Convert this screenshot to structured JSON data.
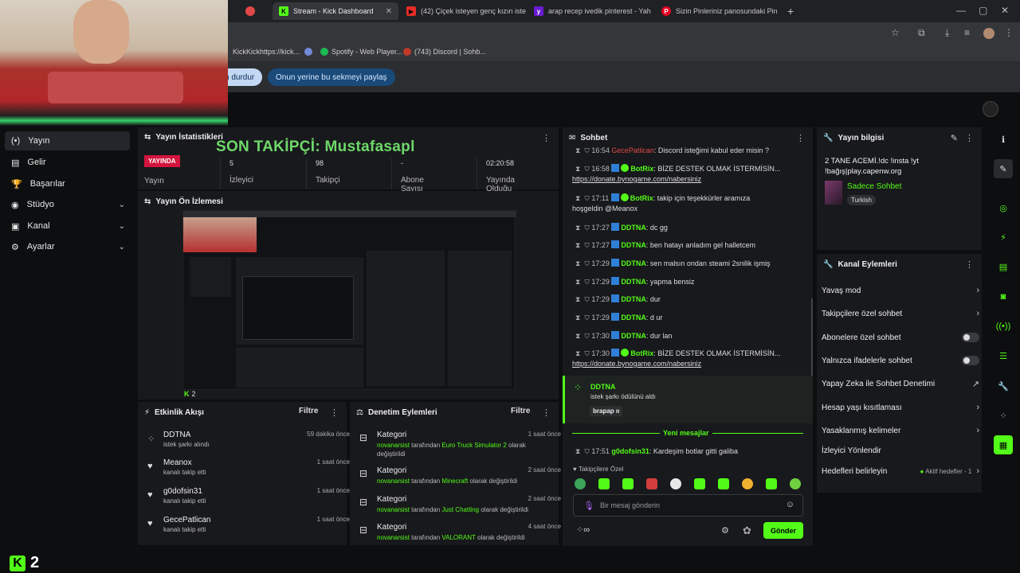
{
  "browser": {
    "tabs": [
      {
        "label": "",
        "active": false
      },
      {
        "label": "Stream - Kick Dashboard",
        "active": true
      },
      {
        "label": "(42) Çiçek isteyen genç kızın iste",
        "active": false
      },
      {
        "label": "arap recep ivedik pinterest - Yah",
        "active": false
      },
      {
        "label": "Sizin Pinleriniz panosundaki Pin",
        "active": false
      }
    ],
    "new_tab": "+",
    "bookmarks": [
      {
        "label": "KickKickhttps://kick..."
      },
      {
        "label": "Spotify - Web Player..."
      },
      {
        "label": "(743) Discord | Sohb..."
      }
    ],
    "share_stop": "n durdur",
    "share_instead": "Onun yerine bu sekmeyi paylaş"
  },
  "sidebar": {
    "items": [
      {
        "label": "Yayın",
        "icon": "broadcast-icon"
      },
      {
        "label": "Gelir",
        "icon": "income-icon"
      },
      {
        "label": "Başarılar",
        "icon": "trophy-icon"
      },
      {
        "label": "Stüdyo",
        "icon": "studio-icon"
      },
      {
        "label": "Kanal",
        "icon": "channel-icon"
      },
      {
        "label": "Ayarlar",
        "icon": "settings-icon"
      }
    ]
  },
  "stats": {
    "title": "Yayın İstatistikleri",
    "overlay": "SON TAKİPÇİ: Mustafasapl",
    "status_badge": "YAYINDA",
    "status_label": "Yayın",
    "items": [
      {
        "value": "5",
        "label": "İzleyici"
      },
      {
        "value": "98",
        "label": "Takipçi"
      },
      {
        "value": "-",
        "label": "Abone Sayısı"
      },
      {
        "value": "02:20:58",
        "label": "Yayında Olduğu"
      }
    ]
  },
  "preview": {
    "title": "Yayın Ön İzlemesi",
    "viewers": "2"
  },
  "activity": {
    "title": "Etkinlik Akışı",
    "filter": "Filtre",
    "items": [
      {
        "name": "DDTNA",
        "sub": "istek şarkı alındı",
        "time": "59 dakika önce",
        "icon": "redeem-icon"
      },
      {
        "name": "Meanox",
        "sub": "kanalı takip etti",
        "time": "1 saat önce",
        "icon": "heart-icon"
      },
      {
        "name": "g0dofsin31",
        "sub": "kanalı takip etti",
        "time": "1 saat önce",
        "icon": "heart-icon"
      },
      {
        "name": "GecePatlican",
        "sub": "kanalı takip etti",
        "time": "1 saat önce",
        "icon": "heart-icon"
      }
    ]
  },
  "moderation": {
    "title": "Denetim Eylemleri",
    "filter": "Filtre",
    "items": [
      {
        "name": "Kategori",
        "user": "novanarsist",
        "mid": " tarafından ",
        "cat": "Euro Truck Simulator 2",
        "end": " olarak değiştirildi",
        "time": "1 saat önce"
      },
      {
        "name": "Kategori",
        "user": "novanarsist",
        "mid": " tarafından ",
        "cat": "Minecraft",
        "end": " olarak değiştirildi",
        "time": "2 saat önce"
      },
      {
        "name": "Kategori",
        "user": "novanarsist",
        "mid": " tarafından ",
        "cat": "Just Chatting",
        "end": " olarak değiştirildi",
        "time": "2 saat önce"
      },
      {
        "name": "Kategori",
        "user": "novanarsist",
        "mid": " tarafından ",
        "cat": "VALORANT",
        "end": " olarak değiştirildi",
        "time": "4 saat önce"
      }
    ]
  },
  "chat": {
    "title": "Sohbet",
    "messages": [
      {
        "time": "16:54",
        "user": "GecePatlican",
        "text": ": Discord isteğimi kabul eder misin ?",
        "style": "gece"
      },
      {
        "time": "16:58",
        "user": "BotRix",
        "text": ": BİZE DESTEK OLMAK İSTERMİSİN...",
        "link": "https://donate.bynogame.com/nabersiniz",
        "style": "bot"
      },
      {
        "time": "17:11",
        "user": "BotRix",
        "text": ": takip için teşekkürler aramıza",
        "cont": "hoşgeldin @Meanox",
        "style": "bot"
      },
      {
        "time": "17:27",
        "user": "DDTNA",
        "text": ": dc gg",
        "style": "ddt"
      },
      {
        "time": "17:27",
        "user": "DDTNA",
        "text": ": ben hatayı anladım gel halletcem",
        "style": "ddt"
      },
      {
        "time": "17:29",
        "user": "DDTNA",
        "text": ": sen malsın ondan steami 2snilik işmiş",
        "style": "ddt"
      },
      {
        "time": "17:29",
        "user": "DDTNA",
        "text": ": yapma bensiz",
        "style": "ddt"
      },
      {
        "time": "17:29",
        "user": "DDTNA",
        "text": ": dur",
        "style": "ddt"
      },
      {
        "time": "17:29",
        "user": "DDTNA",
        "text": ": d ur",
        "style": "ddt"
      },
      {
        "time": "17:30",
        "user": "DDTNA",
        "text": ": dur lan",
        "style": "ddt"
      },
      {
        "time": "17:30",
        "user": "BotRix",
        "text": ": BİZE DESTEK OLMAK İSTERMİSİN...",
        "link": "https://donate.bynogame.com/nabersiniz",
        "style": "bot"
      }
    ],
    "redeem": {
      "user": "DDTNA",
      "text": "istek şarkı ödülünü aldı",
      "tag": "brapap ıı"
    },
    "new_messages": "Yeni mesajlar",
    "last": {
      "time": "17:51",
      "user": "g0dofsin31",
      "text": ": Kardeşim botlar gitti galiba"
    },
    "followers_only": "Takipçilere Özel",
    "placeholder": "Bir mesaj gönderin",
    "infinity": "∞",
    "send": "Gönder"
  },
  "stream_info": {
    "title": "Yayın bilgisi",
    "stream_title": "2 TANE ACEMİ.!dc !insta !yt !bağış|play.capenw.org",
    "category": "Sadece Sohbet",
    "language": "Turkish"
  },
  "channel_actions": {
    "title": "Kanal Eylemleri",
    "items": [
      {
        "label": "Yavaş mod",
        "ctrl": "chevron"
      },
      {
        "label": "Takipçilere özel sohbet",
        "ctrl": "chevron"
      },
      {
        "label": "Abonelere özel sohbet",
        "ctrl": "toggle"
      },
      {
        "label": "Yalnızca ifadelerle sohbet",
        "ctrl": "toggle"
      },
      {
        "label": "Yapay Zeka ile Sohbet Denetimi",
        "ctrl": "external"
      },
      {
        "label": "Hesap yaşı kısıtlaması",
        "ctrl": "chevron"
      },
      {
        "label": "Yasaklanmış kelimeler",
        "ctrl": "chevron"
      },
      {
        "label": "İzleyici Yönlendir",
        "ctrl": "none"
      },
      {
        "label": "Hedefleri belirleyin",
        "ctrl": "chevron",
        "extra": "Aktif hedefler - 1"
      }
    ]
  },
  "overlay_bottom": {
    "logo": "K",
    "count": "2"
  },
  "colors": {
    "accent": "#53fc18",
    "bg": "#0d0e10",
    "panel": "#18191c",
    "live": "#e0234e"
  }
}
